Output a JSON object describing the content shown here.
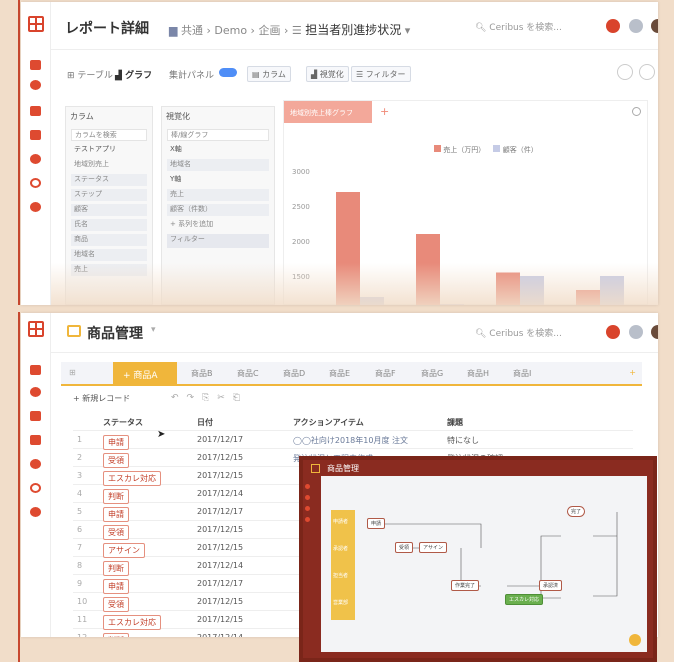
{
  "report": {
    "title": "レポート詳細",
    "breadcrumb": [
      "共通",
      "Demo",
      "企画",
      "担当者別進捗状況"
    ],
    "search_placeholder": "Ceribus を検索...",
    "view_tabs": [
      "テーブル",
      "グラフ"
    ],
    "summary_toggle": "集計パネル",
    "buttons": [
      "カラム",
      "視覚化",
      "フィルター"
    ],
    "column_panel": {
      "title": "カラム",
      "search": "カラムを検索",
      "app": "テストアプリ",
      "group": "地域別売上",
      "items": [
        "ステータス",
        "ステップ",
        "顧客",
        "氏名",
        "商品",
        "地域名",
        "売上"
      ]
    },
    "viz_panel": {
      "title": "視覚化",
      "type": "棒/線グラフ",
      "x_label": "X軸",
      "x_item": "地域名",
      "y_label": "Y軸",
      "y_items": [
        "売上",
        "顧客（件数）"
      ],
      "add": "+ 系列を追加",
      "filter": "フィルター"
    },
    "chart_tab": "地域別売上棒グラフ",
    "legend": [
      "売上（万円）",
      "顧客（件）"
    ]
  },
  "chart_data": {
    "type": "bar",
    "yticks": [
      "3000",
      "2500",
      "2000",
      "1500"
    ],
    "ylim": [
      1000,
      3000
    ],
    "series": [
      {
        "name": "売上（万円）",
        "color": "#e88a7a",
        "values": [
          2700,
          2100,
          1550,
          1300
        ]
      },
      {
        "name": "顧客（件）",
        "color": "#c5cbe6",
        "values": [
          1200,
          1100,
          1500,
          1500
        ]
      }
    ]
  },
  "products": {
    "title": "商品管理",
    "search_placeholder": "Ceribus を検索...",
    "active_tab": "商品A",
    "tabs": [
      "商品B",
      "商品C",
      "商品D",
      "商品E",
      "商品F",
      "商品G",
      "商品H",
      "商品I"
    ],
    "new_record": "新規レコード",
    "columns": [
      "ステータス",
      "日付",
      "アクションアイテム",
      "課題"
    ],
    "rows": [
      {
        "n": "1",
        "status": "申請",
        "date": "2017/12/17",
        "action": "◯◯社向け2018年10月度 注文",
        "issue": "特になし"
      },
      {
        "n": "2",
        "status": "受領",
        "date": "2017/12/15",
        "action": "発注状況と工程表作成",
        "issue": "発注状況の確認"
      },
      {
        "n": "3",
        "status": "エスカレ対応",
        "date": "2017/12/15",
        "action": "",
        "issue": ""
      },
      {
        "n": "4",
        "status": "判断",
        "date": "2017/12/14",
        "action": "",
        "issue": ""
      },
      {
        "n": "5",
        "status": "申請",
        "date": "2017/12/17",
        "action": "",
        "issue": ""
      },
      {
        "n": "6",
        "status": "受領",
        "date": "2017/12/15",
        "action": "",
        "issue": ""
      },
      {
        "n": "7",
        "status": "アサイン",
        "date": "2017/12/15",
        "action": "",
        "issue": ""
      },
      {
        "n": "8",
        "status": "判断",
        "date": "2017/12/14",
        "action": "",
        "issue": ""
      },
      {
        "n": "9",
        "status": "申請",
        "date": "2017/12/17",
        "action": "",
        "issue": ""
      },
      {
        "n": "10",
        "status": "受領",
        "date": "2017/12/15",
        "action": "",
        "issue": ""
      },
      {
        "n": "11",
        "status": "エスカレ対応",
        "date": "2017/12/15",
        "action": "",
        "issue": ""
      },
      {
        "n": "12",
        "status": "判断",
        "date": "2017/12/14",
        "action": "",
        "issue": ""
      }
    ]
  },
  "flow": {
    "title": "商品管理",
    "lanes": [
      "申請者",
      "承認者",
      "担当者",
      "営業部"
    ],
    "nodes": [
      "申請",
      "受領",
      "アサイン",
      "判断",
      "作業完了",
      "エスカレ対応",
      "承認済",
      "完了"
    ]
  },
  "colors": {
    "accent": "#d9442c",
    "yellow": "#f0b63b",
    "green": "#6aaf4e"
  }
}
